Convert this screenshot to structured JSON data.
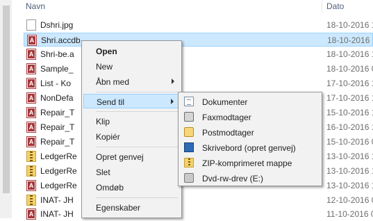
{
  "header": {
    "name": "Navn",
    "date": "Dato"
  },
  "files": [
    {
      "name": "Dshri.jpg",
      "date": "18-10-2016 1",
      "icon": "image-file-icon"
    },
    {
      "name": "Shri.accdb",
      "date": "18-10-2016 1",
      "icon": "access-file-icon"
    },
    {
      "name": "Shri-be.a",
      "date": "18-10-2016 1",
      "icon": "access-file-icon"
    },
    {
      "name": "Sample_",
      "date": "18-10-2016 0",
      "icon": "access-file-icon"
    },
    {
      "name": "List - Ko",
      "date": "17-10-2016 1",
      "icon": "access-file-icon"
    },
    {
      "name": "NonDefa",
      "date": "17-10-2016 1",
      "icon": "access-file-icon"
    },
    {
      "name": "Repair_T",
      "date": "15-10-2016 1",
      "icon": "access-file-icon"
    },
    {
      "name": "Repair_T",
      "date": "16-10-2016 1",
      "icon": "access-file-icon"
    },
    {
      "name": "Repair_T",
      "date": "15-10-2016 0",
      "icon": "access-file-icon"
    },
    {
      "name": "LedgerRe",
      "date": "13-10-2016 1",
      "icon": "zip-file-icon"
    },
    {
      "name": "LedgerRe",
      "date": "13-10-2016 1",
      "icon": "zip-file-icon"
    },
    {
      "name": "LedgerRe",
      "date": "13-10-2016 1",
      "icon": "access-file-icon"
    },
    {
      "name": "INAT- JH",
      "date": "12-10-2016 0",
      "icon": "zip-file-icon"
    },
    {
      "name": "INAT- JH",
      "date": "11-10-2016 0",
      "icon": "access-file-icon"
    }
  ],
  "context_menu": {
    "open": "Open",
    "new": "New",
    "open_with": "Åbn med",
    "send_to": "Send til",
    "cut": "Klip",
    "copy": "Kopiér",
    "create_shortcut": "Opret genvej",
    "delete": "Slet",
    "rename": "Omdøb",
    "properties": "Egenskaber"
  },
  "send_to_menu": {
    "documents": "Dokumenter",
    "fax": "Faxmodtager",
    "mail": "Postmodtager",
    "desktop": "Skrivebord (opret genvej)",
    "zip": "ZIP-komprimeret mappe",
    "dvd": "Dvd-rw-drev (E:)"
  }
}
